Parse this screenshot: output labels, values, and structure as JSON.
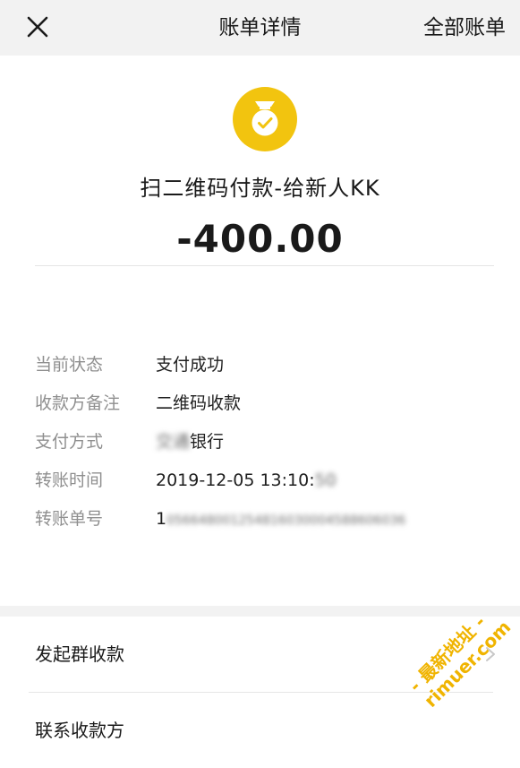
{
  "nav": {
    "title": "账单详情",
    "right_link": "全部账单"
  },
  "transaction": {
    "icon": "money-bag-check-icon",
    "icon_color": "#f2c40f",
    "title": "扫二维码付款-给新人KK",
    "amount": "-400.00"
  },
  "details": [
    {
      "label": "当前状态",
      "value": "支付成功"
    },
    {
      "label": "收款方备注",
      "value": "二维码收款"
    },
    {
      "label": "支付方式",
      "value_blurred": "交通",
      "value": "银行"
    },
    {
      "label": "转账时间",
      "value": "2019-12-05 13:10:",
      "value_blurred": "50"
    },
    {
      "label": "转账单号",
      "value": "1",
      "value_blurred": "056648001254816030004588606036"
    }
  ],
  "actions": [
    {
      "label": "发起群收款"
    },
    {
      "label": "联系收款方"
    }
  ],
  "watermark": {
    "line1": "- 最新地址 -",
    "line2": "rimuer.com"
  }
}
